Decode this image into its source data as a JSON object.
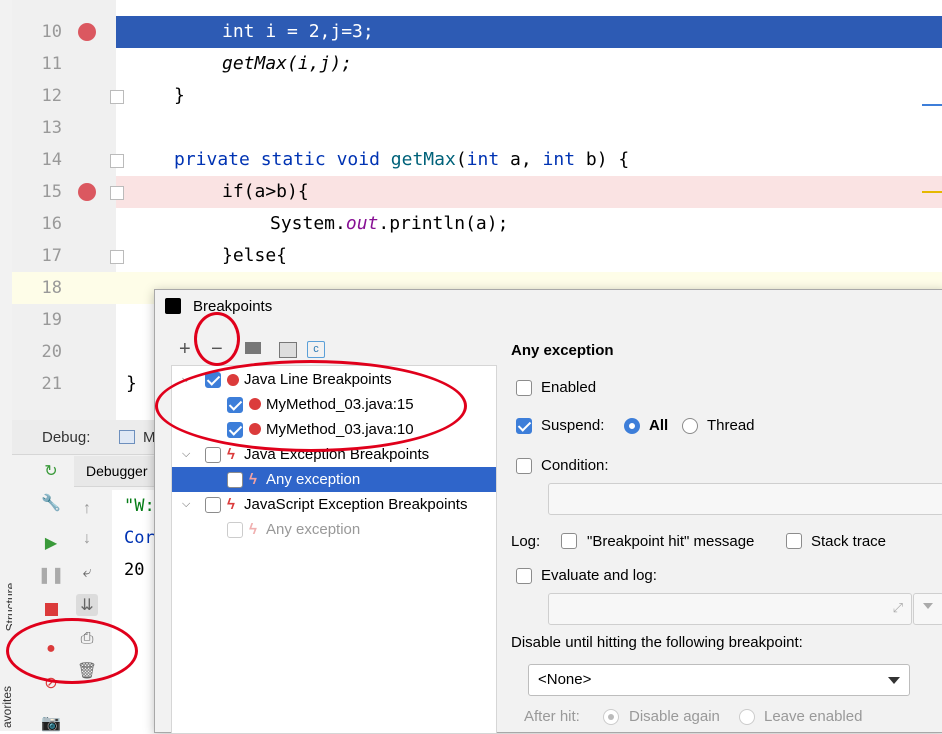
{
  "editor": {
    "lines": [
      {
        "num": "10",
        "code": "int i = 2,j=3;",
        "kind": "current"
      },
      {
        "num": "11",
        "code": "getMax(i,j);"
      },
      {
        "num": "12",
        "code": "}"
      },
      {
        "num": "13",
        "code": ""
      },
      {
        "num": "14",
        "code_parts": [
          "private",
          " ",
          "static",
          " ",
          "void",
          " ",
          "getMax",
          "(",
          "int",
          " a, ",
          "int",
          " b) {"
        ]
      },
      {
        "num": "15",
        "code": "if(a>b){",
        "kind": "breakpoint"
      },
      {
        "num": "16",
        "code_parts": [
          "System.",
          "out",
          ".println(a);"
        ]
      },
      {
        "num": "17",
        "code": "}else{"
      },
      {
        "num": "18",
        "code": ""
      },
      {
        "num": "19",
        "code": ""
      },
      {
        "num": "20",
        "code": ""
      },
      {
        "num": "21",
        "code": "}"
      }
    ]
  },
  "side_tabs": {
    "structure": "Structure",
    "favorites": "avorites"
  },
  "debug": {
    "label": "Debug:",
    "tab_partial": "M",
    "subtab": "Debugger",
    "console_lines": [
      "\"W:",
      "Cor",
      "20"
    ]
  },
  "dialog": {
    "title": "Breakpoints",
    "tree": [
      {
        "label": "Java Line Breakpoints",
        "checked": true,
        "level": 0,
        "icon": "red-dot-icon"
      },
      {
        "label": "MyMethod_03.java:15",
        "checked": true,
        "level": 1,
        "icon": "breakpoint-check-icon"
      },
      {
        "label": "MyMethod_03.java:10",
        "checked": true,
        "level": 1,
        "icon": "breakpoint-check-icon"
      },
      {
        "label": "Java Exception Breakpoints",
        "checked": false,
        "level": 0,
        "icon": "lightning-icon"
      },
      {
        "label": "Any exception",
        "checked": false,
        "level": 1,
        "icon": "lightning-icon",
        "selected": true
      },
      {
        "label": "JavaScript Exception Breakpoints",
        "checked": false,
        "level": 0,
        "icon": "lightning-icon"
      },
      {
        "label": "Any exception",
        "checked": false,
        "level": 1,
        "icon": "lightning-icon",
        "dim": true
      }
    ],
    "details": {
      "heading": "Any exception",
      "enabled": "Enabled",
      "suspend": "Suspend:",
      "all": "All",
      "thread": "Thread",
      "condition": "Condition:",
      "log": "Log:",
      "bp_hit_msg": "\"Breakpoint hit\" message",
      "stack_trace": "Stack trace",
      "eval_log": "Evaluate and log:",
      "disable_until": "Disable until hitting the following breakpoint:",
      "none_option": "<None>",
      "after_hit": "After hit:",
      "disable_again": "Disable again",
      "leave_enabled": "Leave enabled"
    }
  },
  "colors": {
    "current_line": "#2d5bb4",
    "breakpoint_line": "#fae3e3",
    "selection": "#2f65ca",
    "annotation": "#e0001b"
  }
}
